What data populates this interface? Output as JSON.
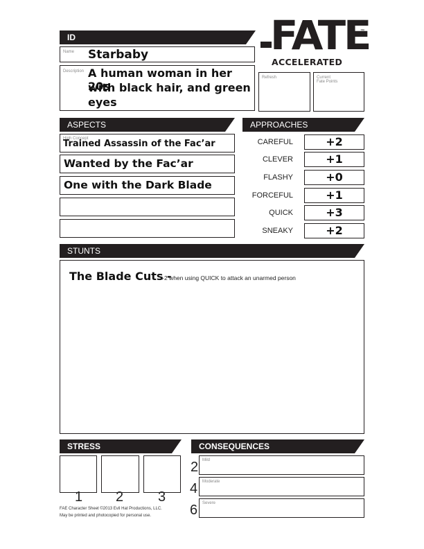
{
  "logo": {
    "main": "FATE",
    "sub": "ACCELERATED",
    "tm": "™"
  },
  "id": {
    "header": "ID",
    "name_label": "Name",
    "name": "Starbaby",
    "description_label": "Description",
    "description_lines": [
      "A human woman in her 20s",
      "with black hair, and green",
      "eyes"
    ],
    "refresh_label": "Refresh",
    "refresh_value": "",
    "fate_points_label_1": "Current",
    "fate_points_label_2": "Fate Points",
    "fate_points_value": ""
  },
  "aspects": {
    "header": "ASPECTS",
    "high_concept_label": "High Concept",
    "items": [
      "Trained Assassin of the Fac’ar",
      "Wanted by the Fac’ar",
      "One with the Dark Blade",
      "",
      ""
    ]
  },
  "approaches": {
    "header": "APPROACHES",
    "items": [
      {
        "label": "CAREFUL",
        "value": "+2"
      },
      {
        "label": "CLEVER",
        "value": "+1"
      },
      {
        "label": "FLASHY",
        "value": "+0"
      },
      {
        "label": "FORCEFUL",
        "value": "+1"
      },
      {
        "label": "QUICK",
        "value": "+3"
      },
      {
        "label": "SNEAKY",
        "value": "+2"
      }
    ]
  },
  "stunts": {
    "header": "STUNTS",
    "name": "The Blade Cuts -",
    "description": "+2 when using QUICK to attack an unarmed person"
  },
  "stress": {
    "header": "STRESS",
    "boxes": [
      "1",
      "2",
      "3"
    ]
  },
  "consequences": {
    "header": "CONSEQUENCES",
    "items": [
      {
        "number": "2",
        "label": "Mild",
        "value": ""
      },
      {
        "number": "4",
        "label": "Moderate",
        "value": ""
      },
      {
        "number": "6",
        "label": "Severe",
        "value": ""
      }
    ]
  },
  "footer": {
    "line1": "FAE Character Sheet ©2013 Evil Hat Productions, LLC.",
    "line2": "May be printed and photocopied for personal use."
  }
}
